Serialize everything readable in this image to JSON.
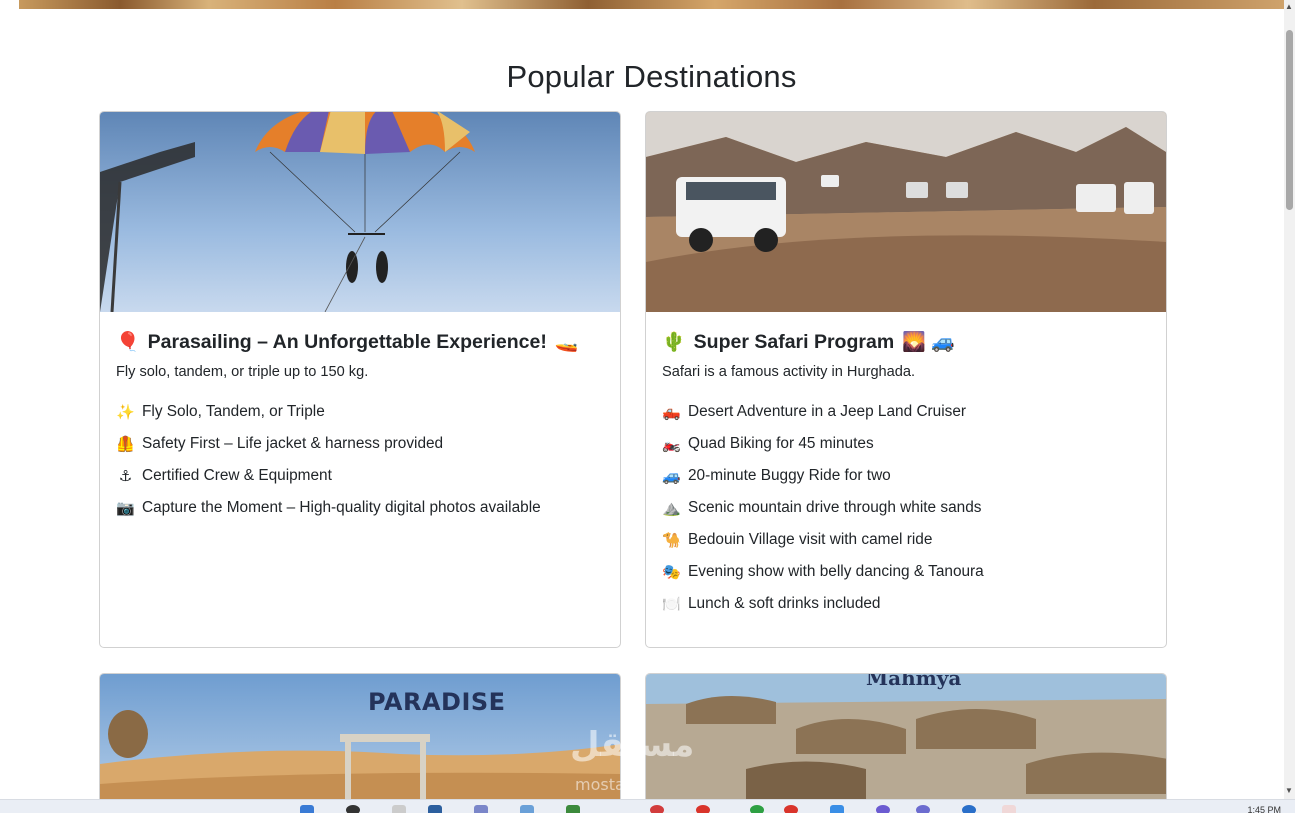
{
  "section": {
    "title": "Popular Destinations"
  },
  "cards": [
    {
      "title": "Parasailing – An Unforgettable Experience!",
      "title_emoji_before": "🎈",
      "title_emoji_after": "🚤",
      "description": "Fly solo, tandem, or triple up to 150 kg.",
      "features": [
        {
          "icon": "✨",
          "text": "Fly Solo, Tandem, or Triple"
        },
        {
          "icon": "🦺",
          "text": "Safety First – Life jacket & harness provided"
        },
        {
          "icon": "⚓",
          "text": "Certified Crew & Equipment"
        },
        {
          "icon": "📷",
          "text": "Capture the Moment – High-quality digital photos available"
        }
      ]
    },
    {
      "title": "Super Safari Program",
      "title_emoji_before": "🌵",
      "title_emoji_after": "🌄 🚙",
      "description": "Safari is a famous activity in Hurghada.",
      "features": [
        {
          "icon": "🛻",
          "text": "Desert Adventure in a Jeep Land Cruiser"
        },
        {
          "icon": "🏍️",
          "text": "Quad Biking for 45 minutes"
        },
        {
          "icon": "🚙",
          "text": "20-minute Buggy Ride for two"
        },
        {
          "icon": "⛰️",
          "text": "Scenic mountain drive through white sands"
        },
        {
          "icon": "🐪",
          "text": "Bedouin Village visit with camel ride"
        },
        {
          "icon": "🎭",
          "text": "Evening show with belly dancing & Tanoura"
        },
        {
          "icon": "🍽️",
          "text": "Lunch & soft drinks included"
        }
      ]
    }
  ],
  "image_text": {
    "card3_sign": "PARADISE",
    "card4_sign": "Mahmya"
  },
  "watermark": {
    "main": "مستقل",
    "sub": "mostaql"
  },
  "taskbar": {
    "clock": "1:45 PM"
  }
}
